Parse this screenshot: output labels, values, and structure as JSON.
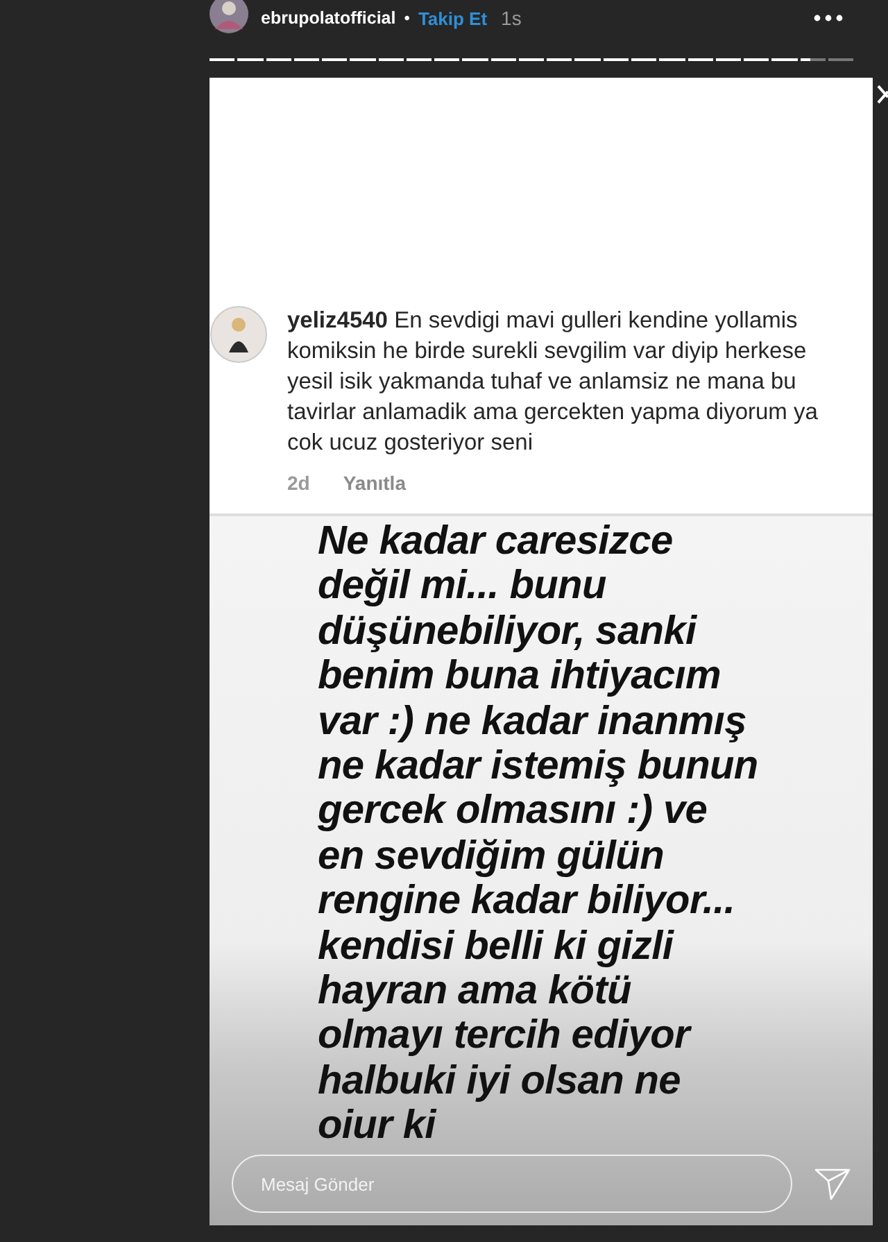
{
  "header": {
    "username": "ebrupolatofficial",
    "separator": "•",
    "follow": "Takip Et",
    "time": "1s"
  },
  "progress": [
    {
      "viewed": true,
      "selected": false
    },
    {
      "viewed": true,
      "selected": false
    },
    {
      "viewed": true,
      "selected": false
    },
    {
      "viewed": true,
      "selected": false
    },
    {
      "viewed": true,
      "selected": false
    },
    {
      "viewed": true,
      "selected": false
    },
    {
      "viewed": true,
      "selected": false
    },
    {
      "viewed": true,
      "selected": false
    },
    {
      "viewed": true,
      "selected": false
    },
    {
      "viewed": true,
      "selected": false
    },
    {
      "viewed": true,
      "selected": false
    },
    {
      "viewed": true,
      "selected": false
    },
    {
      "viewed": true,
      "selected": false
    },
    {
      "viewed": true,
      "selected": false
    },
    {
      "viewed": true,
      "selected": false
    },
    {
      "viewed": true,
      "selected": false
    },
    {
      "viewed": true,
      "selected": false
    },
    {
      "viewed": true,
      "selected": false
    },
    {
      "viewed": true,
      "selected": false
    },
    {
      "viewed": true,
      "selected": false
    },
    {
      "viewed": true,
      "selected": false
    },
    {
      "viewed": false,
      "selected": true
    },
    {
      "viewed": false,
      "selected": false
    }
  ],
  "comment": {
    "username": "yeliz4540",
    "text": "En sevdigi mavi gulleri kendine yollamis komiksin he birde surekli sevgilim var diyip herkese yesil isik yakmanda tuhaf ve anlamsiz ne mana bu tavirlar anlamadik ama gercekten yapma diyorum ya cok ucuz gosteriyor seni",
    "age": "2d",
    "reply": "Yanıtla"
  },
  "story_text": [
    "Ne kadar caresizce",
    "değil mi... bunu",
    "düşünebiliyor, sanki",
    "benim buna ihtiyacım",
    "var :) ne kadar inanmış",
    "ne kadar istemiş bunun",
    "gercek olmasını :) ve",
    "en sevdiğim gülün",
    "rengine kadar biliyor...",
    "kendisi belli ki gizli",
    "hayran ama kötü",
    "olmayı tercih ediyor",
    "halbuki iyi olsan ne",
    "oiur ki"
  ],
  "message": {
    "placeholder": "Mesaj Gönder"
  }
}
